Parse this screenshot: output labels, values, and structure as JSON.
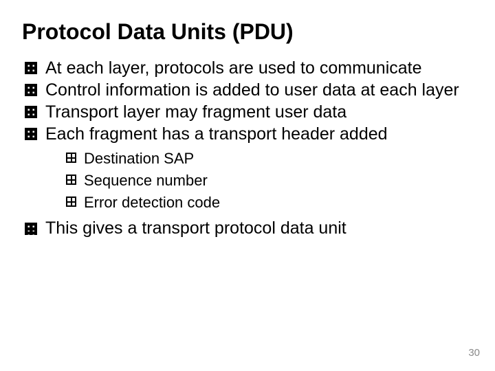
{
  "title": "Protocol Data Units (PDU)",
  "bullets": {
    "b0": "At each layer, protocols are used to communicate",
    "b1": "Control information is added to user data at each layer",
    "b2": "Transport layer may fragment user data",
    "b3": "Each fragment has a transport header added",
    "b4": "This gives a transport protocol data unit"
  },
  "subbullets": {
    "s0": "Destination SAP",
    "s1": "Sequence number",
    "s2": "Error detection code"
  },
  "page_number": "30"
}
